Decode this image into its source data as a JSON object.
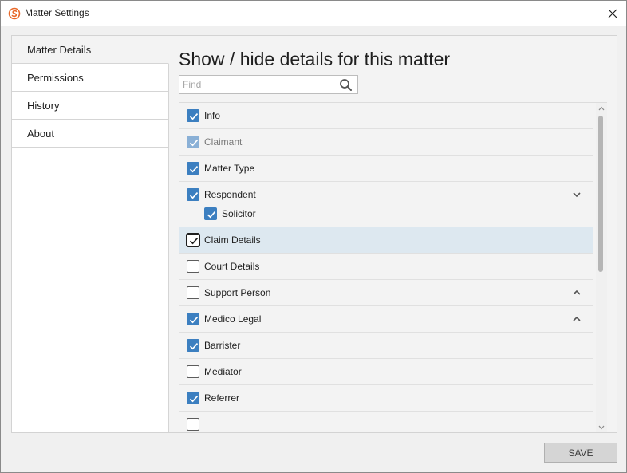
{
  "window": {
    "title": "Matter Settings"
  },
  "sidebar": {
    "items": [
      {
        "label": "Matter Details",
        "active": true
      },
      {
        "label": "Permissions",
        "active": false
      },
      {
        "label": "History",
        "active": false
      },
      {
        "label": "About",
        "active": false
      }
    ]
  },
  "main": {
    "heading": "Show / hide details for this matter",
    "search": {
      "placeholder": "Find",
      "value": ""
    },
    "items": [
      {
        "label": "Info",
        "checked": true,
        "disabled": false
      },
      {
        "label": "Claimant",
        "checked": true,
        "disabled": true
      },
      {
        "label": "Matter Type",
        "checked": true,
        "disabled": false
      },
      {
        "label": "Respondent",
        "checked": true,
        "disabled": false,
        "chevron": "down"
      },
      {
        "label": "Solicitor",
        "checked": true,
        "disabled": false,
        "child": true
      },
      {
        "label": "Claim Details",
        "checked": true,
        "disabled": false,
        "selected": true
      },
      {
        "label": "Court Details",
        "checked": false,
        "disabled": false
      },
      {
        "label": "Support Person",
        "checked": false,
        "disabled": false,
        "chevron": "up"
      },
      {
        "label": "Medico Legal",
        "checked": true,
        "disabled": false,
        "chevron": "up"
      },
      {
        "label": "Barrister",
        "checked": true,
        "disabled": false
      },
      {
        "label": "Mediator",
        "checked": false,
        "disabled": false
      },
      {
        "label": "Referrer",
        "checked": true,
        "disabled": false
      }
    ]
  },
  "footer": {
    "save_label": "SAVE"
  },
  "colors": {
    "accent": "#3c7fc0",
    "selected_row": "#dde8f0",
    "brand_icon": "#e8692a"
  }
}
